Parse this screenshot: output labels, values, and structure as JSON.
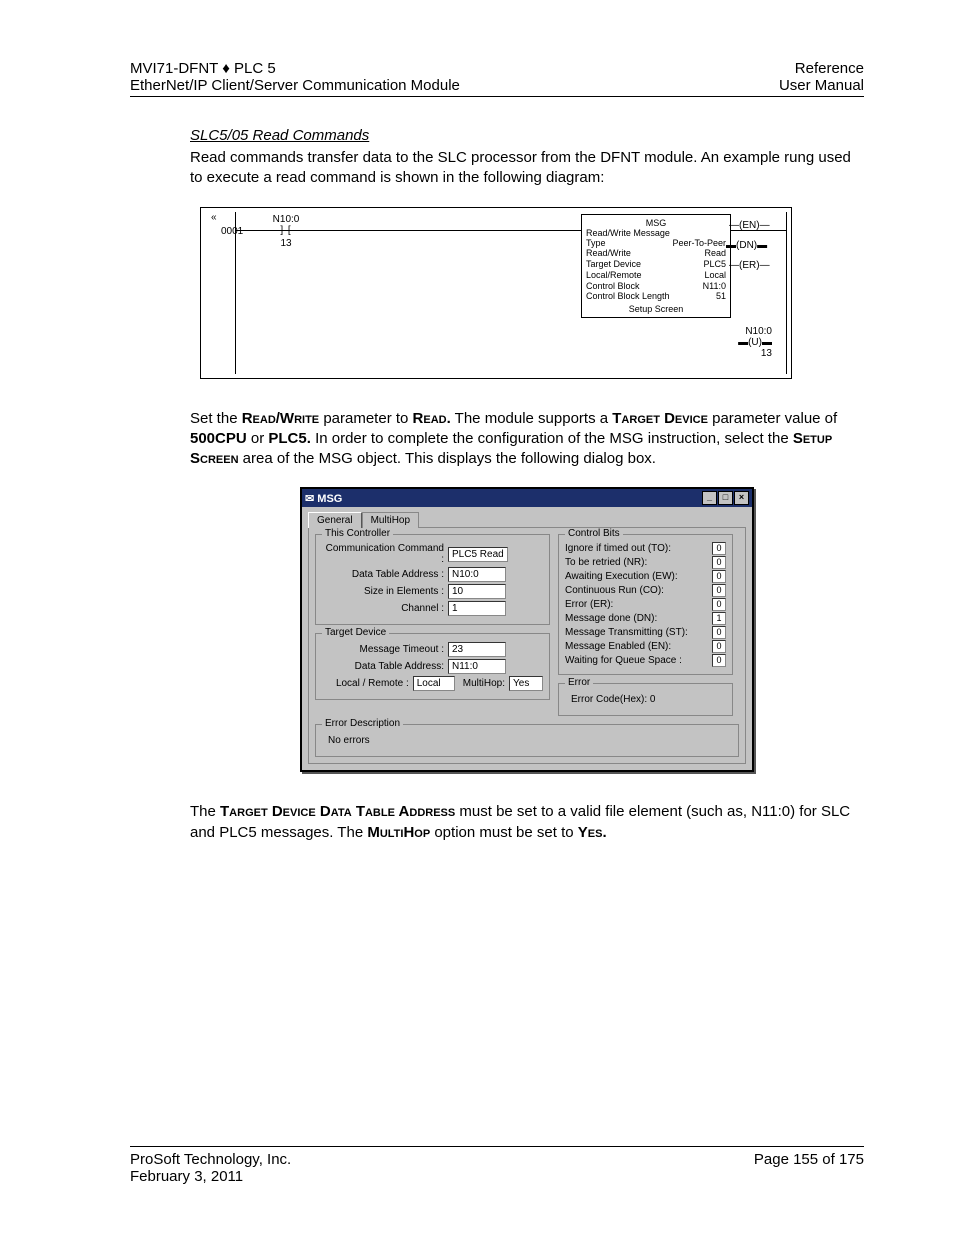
{
  "header": {
    "left1": "MVI71-DFNT ♦ PLC 5",
    "left2": "EtherNet/IP Client/Server Communication Module",
    "right1": "Reference",
    "right2": "User Manual"
  },
  "section_title": "SLC5/05 Read Commands",
  "para1": "Read commands transfer data to the SLC processor from the DFNT module. An example rung used to execute a read command is shown in the following diagram:",
  "ladder": {
    "rung_no": "0001",
    "x": "«",
    "contact_tag": "N10:0",
    "contact_bit": "13",
    "msg": {
      "heading": "MSG",
      "sub": "Read/Write Message",
      "rows": [
        [
          "Type",
          "Peer-To-Peer"
        ],
        [
          "Read/Write",
          "Read"
        ],
        [
          "Target Device",
          "PLC5"
        ],
        [
          "Local/Remote",
          "Local"
        ],
        [
          "Control Block",
          "N11:0"
        ],
        [
          "Control Block Length",
          "51"
        ]
      ],
      "setup": "Setup Screen"
    },
    "flags": {
      "en": "EN",
      "dn": "DN",
      "er": "ER"
    },
    "out_tag": "N10:0",
    "out_bit": "13",
    "out_sym": "U"
  },
  "para2_pre": "Set the ",
  "para2_rw": "Read/Write",
  "para2_mid1": " parameter to ",
  "para2_read": "Read.",
  "para2_mid2": " The module supports a ",
  "para2_td": "Target Device",
  "para2_mid3": " parameter value of ",
  "para2_cpu": "500CPU",
  "para2_or": " or ",
  "para2_plc5": "PLC5.",
  "para2_mid4": " In order to complete the configuration of the MSG instruction, select the ",
  "para2_ss": "Setup Screen",
  "para2_end": " area of the MSG object. This displays the following dialog box.",
  "dialog": {
    "title": "MSG",
    "tabs": {
      "general": "General",
      "multihop": "MultiHop"
    },
    "this_controller": {
      "legend": "This Controller",
      "comm_cmd_l": "Communication Command :",
      "comm_cmd_v": "PLC5 Read",
      "dta_l": "Data Table Address :",
      "dta_v": "N10:0",
      "size_l": "Size in Elements :",
      "size_v": "10",
      "chan_l": "Channel :",
      "chan_v": "1"
    },
    "target_device": {
      "legend": "Target Device",
      "to_l": "Message Timeout :",
      "to_v": "23",
      "dta_l": "Data Table Address:",
      "dta_v": "N11:0",
      "lr_l": "Local / Remote :",
      "lr_v": "Local",
      "mh_l": "MultiHop:",
      "mh_v": "Yes"
    },
    "control_bits": {
      "legend": "Control Bits",
      "rows": [
        [
          "Ignore if timed out (TO):",
          "0"
        ],
        [
          "To be retried (NR):",
          "0"
        ],
        [
          "Awaiting Execution (EW):",
          "0"
        ],
        [
          "Continuous Run (CO):",
          "0"
        ],
        [
          "Error (ER):",
          "0"
        ],
        [
          "Message done (DN):",
          "1"
        ],
        [
          "Message Transmitting (ST):",
          "0"
        ],
        [
          "Message Enabled (EN):",
          "0"
        ],
        [
          "Waiting for Queue Space :",
          "0"
        ]
      ]
    },
    "error": {
      "legend": "Error",
      "text": "Error Code(Hex): 0"
    },
    "error_desc": {
      "legend": "Error Description",
      "text": "No errors"
    }
  },
  "para3_pre": "The ",
  "para3_tdda": "Target Device Data Table Address",
  "para3_mid1": " must be set to a valid file element (such as, N11:0) for SLC and PLC5 messages. The ",
  "para3_mh": "MultiHop",
  "para3_mid2": " option must be set to ",
  "para3_yes": "Yes.",
  "footer": {
    "company": "ProSoft Technology, Inc.",
    "date": "February 3, 2011",
    "page": "Page 155 of 175"
  }
}
